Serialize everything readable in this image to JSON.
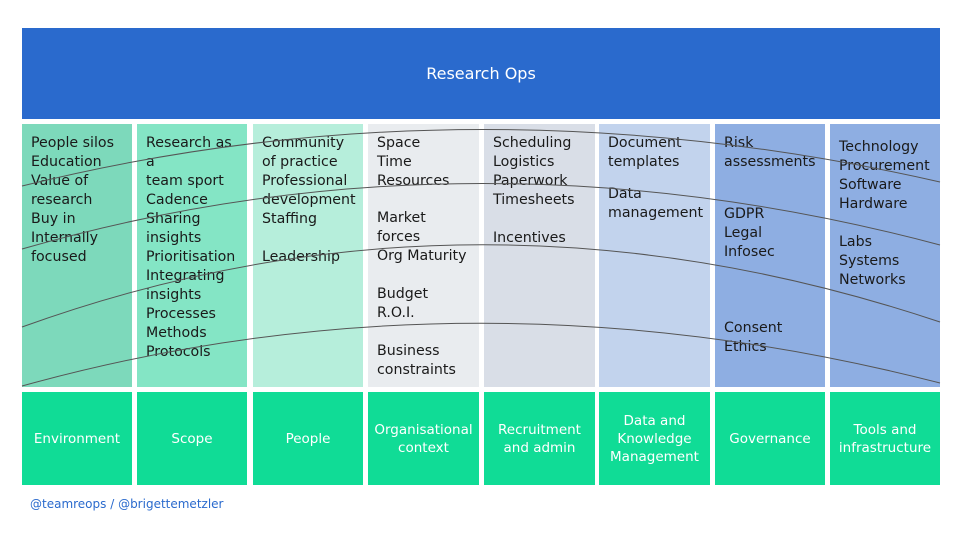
{
  "banner": {
    "title": "Research Ops"
  },
  "columns": [
    {
      "name": "environment",
      "color": "#7dd9bb",
      "groups": [
        [
          "People silos",
          "Education",
          "Value of",
          "research",
          "Buy in",
          "Internally",
          "focused"
        ]
      ]
    },
    {
      "name": "scope",
      "color": "#84e5c5",
      "groups": [
        [
          "Research as a",
          "team sport",
          "Cadence",
          "Sharing",
          "insights",
          "Prioritisation",
          "Integrating",
          "insights",
          "Processes",
          "Methods",
          "Protocols"
        ]
      ]
    },
    {
      "name": "people",
      "color": "#b6eedb",
      "groups": [
        [
          "Community",
          "of practice",
          "Professional",
          "development",
          "Staffing"
        ],
        [
          "Leadership"
        ]
      ]
    },
    {
      "name": "organisational-context",
      "color": "#e9ecef",
      "groups": [
        [
          "Space",
          "Time",
          "Resources"
        ],
        [
          "Market forces",
          "Org Maturity"
        ],
        [
          "Budget",
          "R.O.I."
        ],
        [
          "Business",
          "constraints"
        ]
      ]
    },
    {
      "name": "recruitment-and-admin",
      "color": "#d9dee7",
      "groups": [
        [
          "Scheduling",
          "Logistics",
          "Paperwork",
          "Timesheets"
        ],
        [
          "Incentives"
        ]
      ]
    },
    {
      "name": "data-and-knowledge",
      "color": "#c2d3ed",
      "groups": [
        [
          "Document",
          "templates"
        ],
        [
          "Data",
          "management"
        ]
      ]
    },
    {
      "name": "governance",
      "color": "#8eaee2",
      "groups": [
        [
          "Risk",
          "assessments"
        ],
        [
          "GDPR",
          "Legal",
          "Infosec"
        ],
        [
          "Consent",
          "Ethics"
        ]
      ]
    },
    {
      "name": "tools-and-infrastructure",
      "color": "#8eaee2",
      "groups": [
        [
          "Technology",
          "Procurement",
          "Software",
          "Hardware"
        ],
        [
          "Labs",
          "Systems",
          "Networks"
        ]
      ]
    }
  ],
  "base": [
    {
      "label": "Environment"
    },
    {
      "label": "Scope"
    },
    {
      "label": "People"
    },
    {
      "label": "Organisational\ncontext"
    },
    {
      "label": "Recruitment\nand admin"
    },
    {
      "label": "Data and\nKnowledge\nManagement"
    },
    {
      "label": "Governance"
    },
    {
      "label": "Tools and\ninfrastructure"
    }
  ],
  "footer": {
    "credit": "@teamreops / @brigettemetzler"
  },
  "colors": {
    "banner": "#2a6acd",
    "base": "#10dc96",
    "curve": "#555555"
  }
}
